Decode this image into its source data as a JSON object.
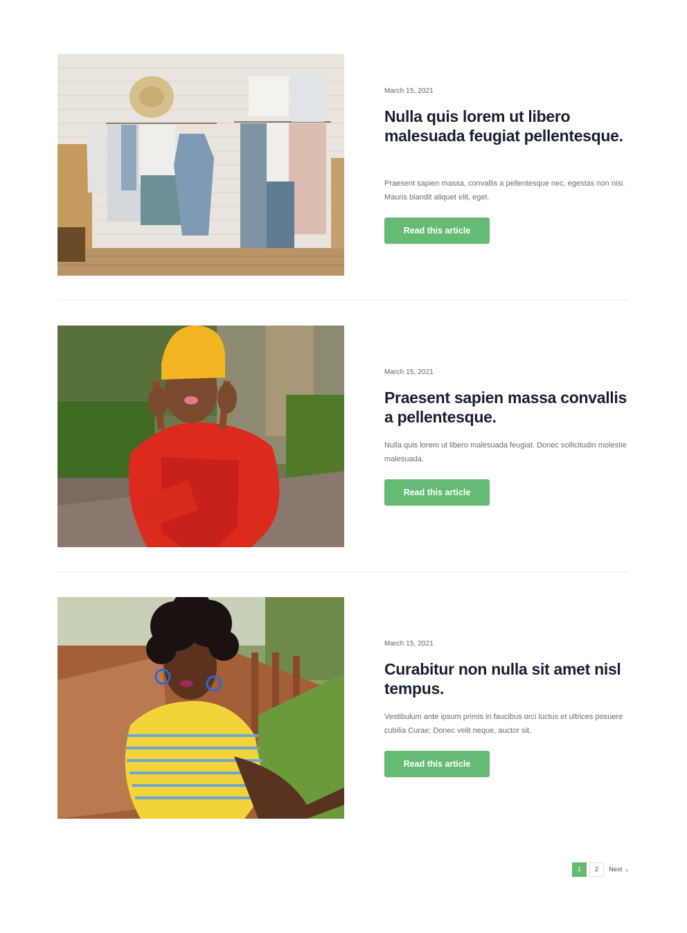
{
  "posts": [
    {
      "date": "March 15, 2021",
      "title": "Nulla quis lorem ut libero malesuada feugiat pellentesque.",
      "excerpt": "Praesent sapien massa, convallis a pellentesque nec, egestas non nisi. Mauris blandit aliquet elit, eget.",
      "button": "Read this article"
    },
    {
      "date": "March 15, 2021",
      "title": "Praesent sapien massa convallis a pellentesque.",
      "excerpt": "Nulla quis lorem ut libero malesuada feugiat. Donec sollicitudin molestie malesuada.",
      "button": "Read this article"
    },
    {
      "date": "March 15, 2021",
      "title": "Curabitur non nulla sit amet nisl tempus.",
      "excerpt": "Vestibulum ante ipsum primis in faucibus orci luctus et ultrices posuere cubilia Curae; Donec velit neque, auctor sit.",
      "button": "Read this article"
    }
  ],
  "pagination": {
    "pages": [
      "1",
      "2"
    ],
    "current": "1",
    "next_label": "Next",
    "next_icon": "chevron-right-icon"
  },
  "colors": {
    "accent": "#66bb74",
    "heading": "#172032",
    "text": "#646b78",
    "divider": "#e9ebee"
  }
}
